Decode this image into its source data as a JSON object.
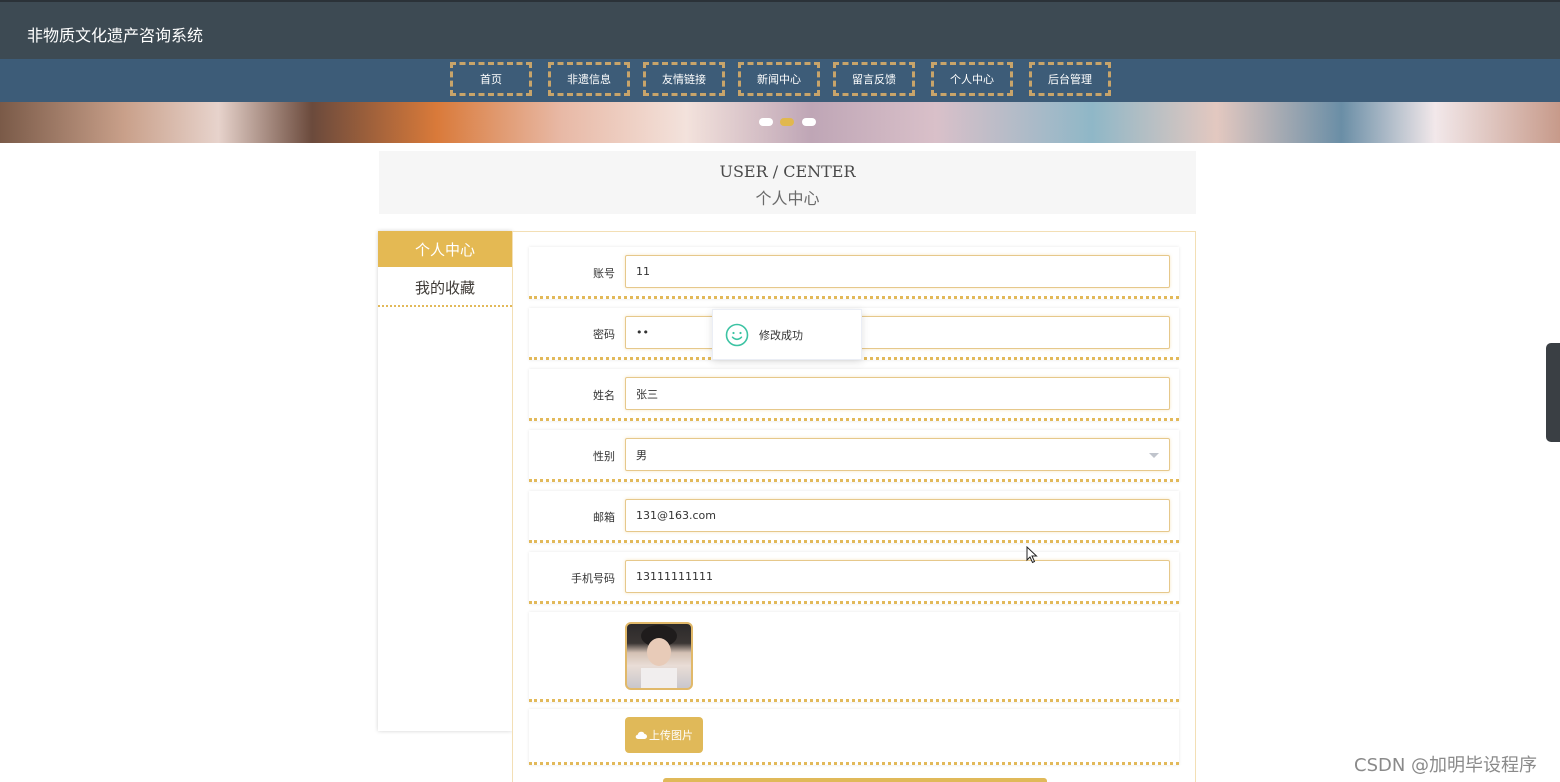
{
  "header": {
    "site_title": "非物质文化遗产咨询系统"
  },
  "nav": {
    "items": [
      "首页",
      "非遗信息",
      "友情链接",
      "新闻中心",
      "留言反馈",
      "个人中心",
      "后台管理"
    ]
  },
  "banner": {
    "slides": 3,
    "active_slide": 2
  },
  "section": {
    "title_en": "USER / CENTER",
    "title_cn": "个人中心"
  },
  "sidebar": {
    "items": [
      {
        "label": "个人中心",
        "active": true
      },
      {
        "label": "我的收藏",
        "active": false
      }
    ]
  },
  "form": {
    "account": {
      "label": "账号",
      "value": "11"
    },
    "password": {
      "label": "密码",
      "value": "••"
    },
    "name": {
      "label": "姓名",
      "value": "张三"
    },
    "gender": {
      "label": "性别",
      "value": "男"
    },
    "email": {
      "label": "邮箱",
      "value": "131@163.com"
    },
    "phone": {
      "label": "手机号码",
      "value": "13111111111"
    },
    "upload_label": "上传图片"
  },
  "toast": {
    "message": "修改成功",
    "icon": "smile-icon"
  },
  "watermark": "CSDN @加明毕设程序",
  "colors": {
    "accent": "#e0b959",
    "header_bg": "#3d4a53",
    "nav_bg": "#3d5c78"
  }
}
